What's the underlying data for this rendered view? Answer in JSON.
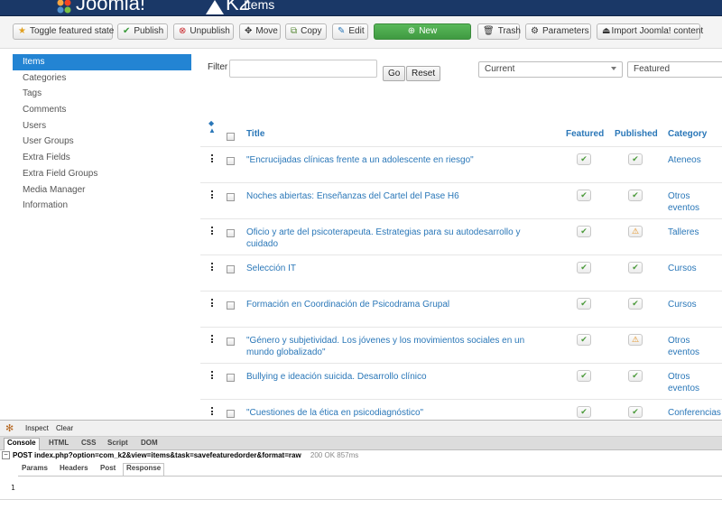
{
  "header": {
    "joomla_brand": "Joomla!",
    "k2_brand": "K2",
    "page_title": "Items"
  },
  "toolbar": {
    "buttons": [
      {
        "label": "Toggle featured state",
        "icon": "star-icon",
        "color": "#e0a020"
      },
      {
        "label": "Publish",
        "icon": "check-icon",
        "color": "#3a9a3a"
      },
      {
        "label": "Unpublish",
        "icon": "cancel-circle-icon",
        "color": "#c8262a"
      },
      {
        "label": "Move",
        "icon": "move-icon",
        "color": "#333333"
      },
      {
        "label": "Copy",
        "icon": "copy-icon",
        "color": "#5a8a3a"
      },
      {
        "label": "Edit",
        "icon": "edit-icon",
        "color": "#2a77b8"
      },
      {
        "label": "New",
        "icon": "plus-circle-icon",
        "color": "#ffffff"
      },
      {
        "label": "Trash",
        "icon": "trash-icon",
        "color": "#333333"
      },
      {
        "label": "Parameters",
        "icon": "gear-icon",
        "color": "#333333"
      },
      {
        "label": "Import Joomla! content",
        "icon": "import-icon",
        "color": "#333333"
      }
    ]
  },
  "sidebar": {
    "items": [
      {
        "label": "Items",
        "active": true
      },
      {
        "label": "Categories"
      },
      {
        "label": "Tags"
      },
      {
        "label": "Comments"
      },
      {
        "label": "Users"
      },
      {
        "label": "User Groups"
      },
      {
        "label": "Extra Fields"
      },
      {
        "label": "Extra Field Groups"
      },
      {
        "label": "Media Manager"
      },
      {
        "label": "Information"
      }
    ]
  },
  "filters": {
    "filter_label": "Filter",
    "filter_value": "",
    "go_label": "Go",
    "reset_label": "Reset",
    "state_select": "Current",
    "featured_select": "Featured"
  },
  "table": {
    "headers": {
      "title": "Title",
      "featured": "Featured",
      "published": "Published",
      "category": "Category"
    },
    "rows": [
      {
        "title": "\"Encrucijadas clínicas frente a un adolescente en riesgo\"",
        "featured": "ok",
        "published": "ok",
        "category": "Ateneos"
      },
      {
        "title": "Noches abiertas: Enseñanzas del Cartel del Pase H6",
        "featured": "ok",
        "published": "ok",
        "category": "Otros eventos"
      },
      {
        "title": "Oficio y arte del psicoterapeuta. Estrategias para su autodesarrollo y cuidado",
        "featured": "ok",
        "published": "warn",
        "category": "Talleres"
      },
      {
        "title": "Selección IT",
        "featured": "ok",
        "published": "ok",
        "category": "Cursos"
      },
      {
        "title": "Formación en Coordinación de Psicodrama Grupal",
        "featured": "ok",
        "published": "ok",
        "category": "Cursos"
      },
      {
        "title": "\"Género y subjetividad. Los jóvenes y los movimientos sociales en un mundo globalizado\"",
        "featured": "ok",
        "published": "warn",
        "category": "Otros eventos"
      },
      {
        "title": "Bullying e ideación suicida. Desarrollo clínico",
        "featured": "ok",
        "published": "ok",
        "category": "Otros eventos"
      },
      {
        "title": "\"Cuestiones de la ética en psicodiagnóstico\"",
        "featured": "ok",
        "published": "ok",
        "category": "Conferencias"
      }
    ]
  },
  "firebug": {
    "inspect_label": "Inspect",
    "clear_label": "Clear",
    "tabs": [
      "Console",
      "HTML",
      "CSS",
      "Script",
      "DOM"
    ],
    "request_method": "POST",
    "request_url": "index.php?option=com_k2&view=items&task=savefeaturedorder&format=raw",
    "request_status": "200 OK 857ms",
    "subtabs": [
      "Params",
      "Headers",
      "Post",
      "Response"
    ],
    "response_body": "1"
  },
  "colors": {
    "header_bg": "#1a3867",
    "link": "#2a77b8",
    "active_sidebar": "#2384d3",
    "new_button": "#46a546"
  }
}
